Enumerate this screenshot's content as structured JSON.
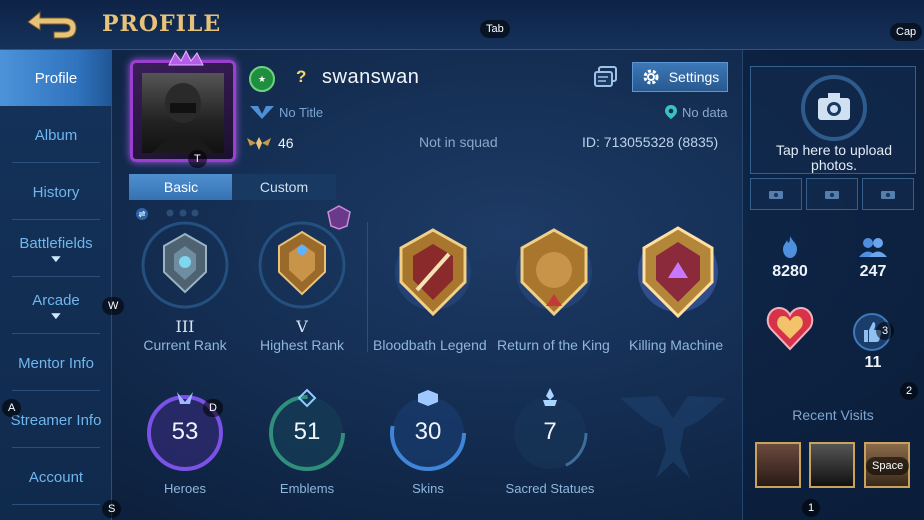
{
  "header": {
    "title": "PROFILE",
    "back_icon": "back-arrow-icon"
  },
  "key_hints": {
    "tab": "Tab",
    "cap": "Cap",
    "w": "W",
    "a": "A",
    "s": "S",
    "d": "D",
    "t": "T",
    "one": "1",
    "two": "2",
    "three": "3",
    "space": "Space"
  },
  "sidebar": {
    "items": [
      {
        "label": "Profile",
        "active": true
      },
      {
        "label": "Album"
      },
      {
        "label": "History"
      },
      {
        "label": "Battlefields",
        "expandable": true
      },
      {
        "label": "Arcade",
        "expandable": true
      },
      {
        "label": "Mentor Info"
      },
      {
        "label": "Streamer Info"
      },
      {
        "label": "Account"
      }
    ]
  },
  "profile": {
    "username": "swanswan",
    "help_mark": "?",
    "title": "No Title",
    "level": "46",
    "squad": "Not in squad",
    "id_text": "ID:  713055328 (8835)",
    "location": "No data",
    "settings_label": "Settings"
  },
  "tabs": {
    "basic": "Basic",
    "custom": "Custom"
  },
  "ranks": {
    "current": {
      "roman": "III",
      "label": "Current Rank"
    },
    "highest": {
      "roman": "V",
      "label": "Highest Rank"
    }
  },
  "achievements": [
    {
      "label": "Bloodbath Legend"
    },
    {
      "label": "Return of the King"
    },
    {
      "label": "Killing Machine"
    }
  ],
  "stats": [
    {
      "value": "53",
      "label": "Heroes",
      "accent": "#8a5cff"
    },
    {
      "value": "51",
      "label": "Emblems",
      "accent": "#3f9c7a"
    },
    {
      "value": "30",
      "label": "Skins",
      "accent": "#3f86d8"
    },
    {
      "value": "7",
      "label": "Sacred Statues",
      "accent": "#4f7fb2"
    }
  ],
  "right_panel": {
    "upload_text_1": "Tap here to upload",
    "upload_text_2": "photos.",
    "popularity": "8280",
    "followers": "247",
    "likes": "11",
    "recent_visits": "Recent Visits"
  },
  "colors": {
    "gold": "#e7c27a",
    "accent_blue": "#3c78b8",
    "purple_frame": "#9b3fd0"
  }
}
